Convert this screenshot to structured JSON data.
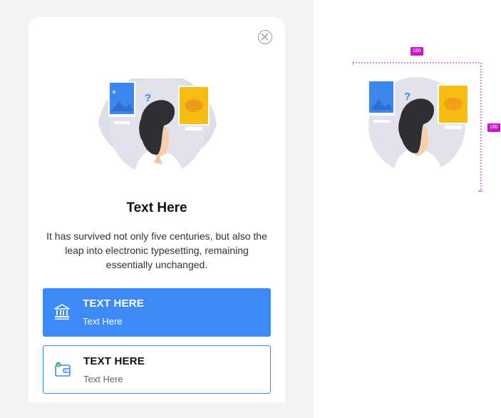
{
  "modal": {
    "close_icon": "close-circle-icon",
    "illustration": "person-thinking-between-image-and-document-illustration",
    "title": "Text Here",
    "description": "It has survived not only five centuries, but also the leap into electronic typesetting, remaining essentially unchanged.",
    "options": [
      {
        "title": "TEXT HERE",
        "subtitle": "Text Here",
        "icon": "bank-icon",
        "selected": true
      },
      {
        "title": "TEXT HERE",
        "subtitle": "Text Here",
        "icon": "wallet-icon",
        "selected": false
      }
    ]
  },
  "spec": {
    "width_label": "180",
    "height_label": "180"
  },
  "colors": {
    "accent": "#3d8af7",
    "spec_marker": "#c21cc7",
    "panel_bg": "#f2f3f5"
  }
}
